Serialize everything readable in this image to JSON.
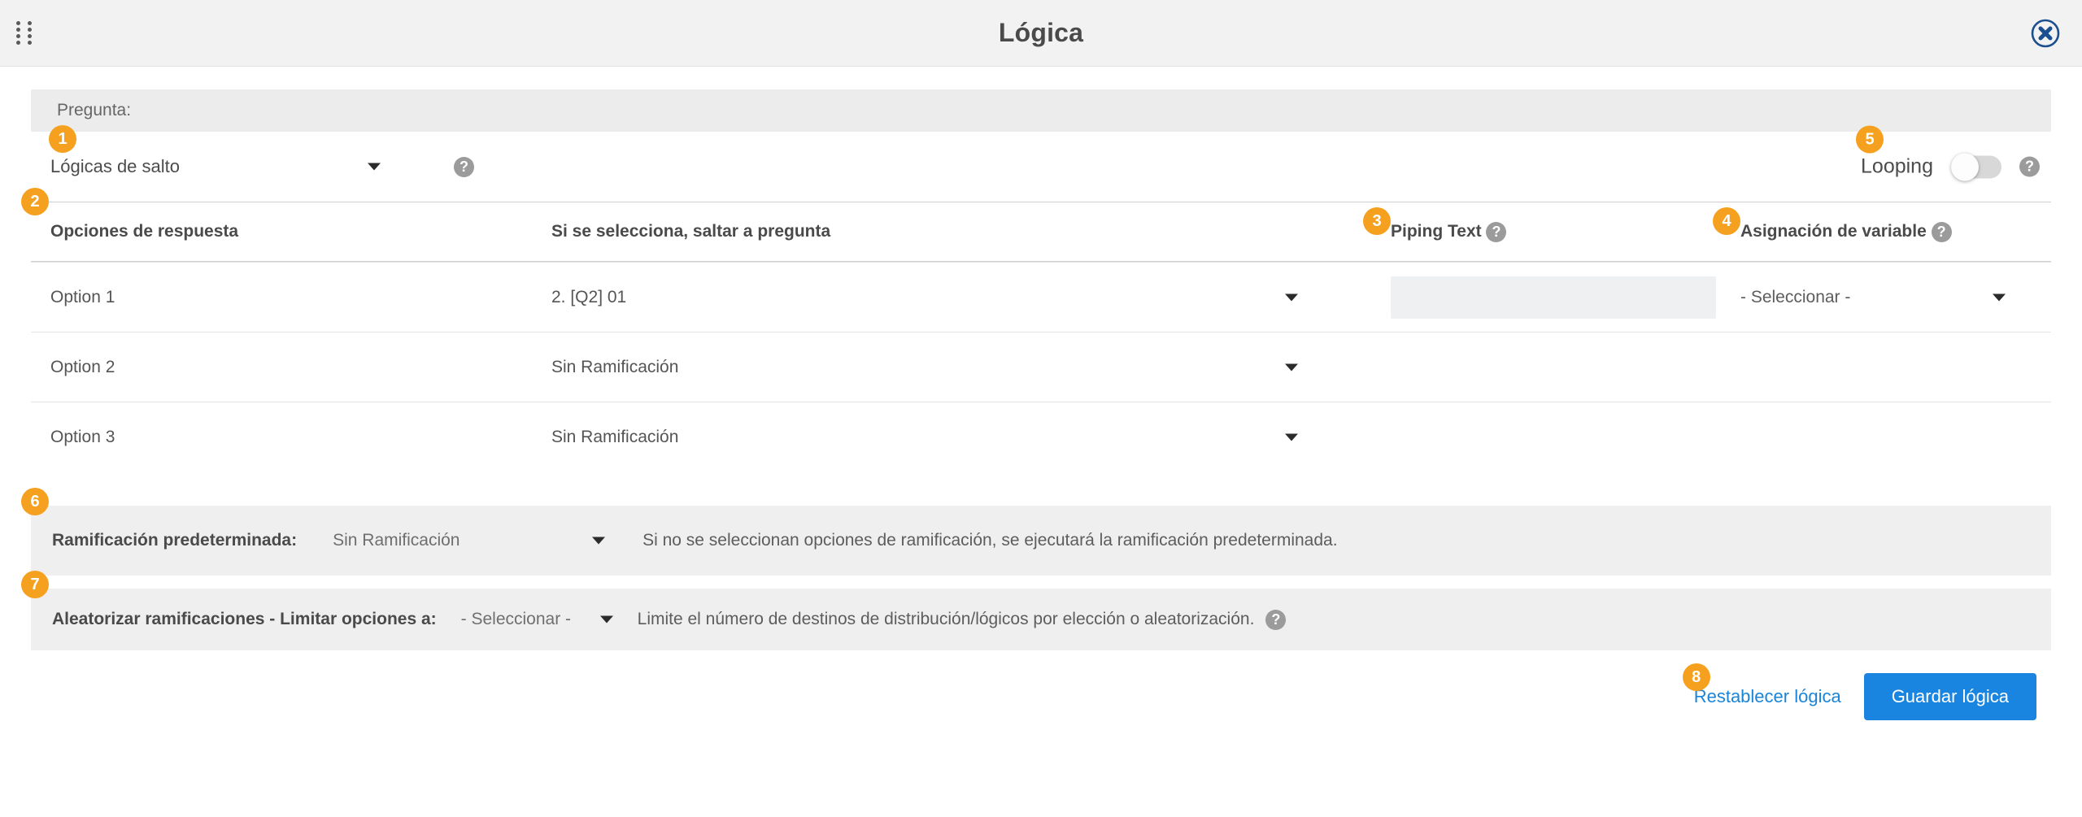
{
  "header": {
    "title": "Lógica",
    "drag_handle_icon": "drag-dots-icon",
    "close_icon": "close-circle-icon"
  },
  "question_bar": {
    "label": "Pregunta:"
  },
  "logic_type": {
    "badge": "1",
    "value": "Lógicas de salto",
    "help_icon": "help-circle-icon"
  },
  "looping": {
    "badge": "5",
    "label": "Looping",
    "enabled": false,
    "help_icon": "help-circle-icon"
  },
  "table": {
    "headers": {
      "option": {
        "label": "Opciones de respuesta",
        "badge": "2"
      },
      "jump": {
        "label": "Si se selecciona, saltar a pregunta"
      },
      "piping": {
        "label": "Piping Text",
        "badge": "3",
        "help_icon": "help-circle-icon"
      },
      "variable": {
        "label": "Asignación de variable",
        "badge": "4",
        "help_icon": "help-circle-icon"
      }
    },
    "rows": [
      {
        "option": "Option 1",
        "jump": "2. [Q2] 01",
        "piping_value": "",
        "piping_placeholder": "",
        "variable": "- Seleccionar -",
        "has_piping": true,
        "has_variable": true
      },
      {
        "option": "Option 2",
        "jump": "Sin Ramificación",
        "piping_value": "",
        "piping_placeholder": "",
        "variable": "",
        "has_piping": false,
        "has_variable": false
      },
      {
        "option": "Option 3",
        "jump": "Sin Ramificación",
        "piping_value": "",
        "piping_placeholder": "",
        "variable": "",
        "has_piping": false,
        "has_variable": false
      }
    ]
  },
  "default_branching": {
    "badge": "6",
    "label": "Ramificación predeterminada:",
    "value": "Sin Ramificación",
    "note": "Si no se seleccionan opciones de ramificación, se ejecutará la ramificación predeterminada."
  },
  "randomize": {
    "badge": "7",
    "label": "Aleatorizar ramificaciones - Limitar opciones a:",
    "value": "- Seleccionar -",
    "note": "Limite el número de destinos de distribución/lógicos por elección o aleatorización.",
    "help_icon": "help-circle-icon"
  },
  "footer": {
    "reset_label": "Restablecer lógica",
    "reset_badge": "8",
    "save_label": "Guardar lógica"
  },
  "colors": {
    "badge_orange": "#f5a01e",
    "primary_blue": "#1a85e0",
    "link_blue": "#1a84d6",
    "panel_grey": "#efefef",
    "header_grey": "#f2f2f2"
  }
}
